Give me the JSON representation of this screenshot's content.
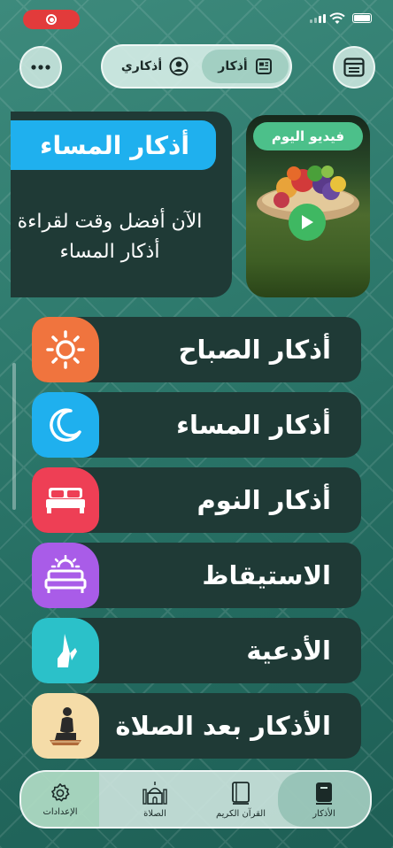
{
  "status_bar": {
    "recording": true
  },
  "header": {
    "segments": [
      {
        "label": "أذكار",
        "active": true,
        "icon": "news-icon"
      },
      {
        "label": "أذكاري",
        "active": false,
        "icon": "user-icon"
      }
    ],
    "left_button_icon": "more-icon",
    "right_button_icon": "list-icon"
  },
  "featured": {
    "title": "أذكار المساء",
    "line1": "الآن أفضل وقت لقراءة",
    "line2": "أذكار المساء",
    "video_title": "فيديو اليوم"
  },
  "items": [
    {
      "label": "أذكار الصباح",
      "color": "#f0743e",
      "icon": "sun-icon"
    },
    {
      "label": "أذكار المساء",
      "color": "#1fb0ee",
      "icon": "moon-icon"
    },
    {
      "label": "أذكار النوم",
      "color": "#ee3f55",
      "icon": "bed-icon"
    },
    {
      "label": "الاستيقاظ",
      "color": "#a95ce8",
      "icon": "wake-bed-icon"
    },
    {
      "label": "الأدعية",
      "color": "#2bc1c9",
      "icon": "prayer-hands-icon"
    },
    {
      "label": "الأذكار بعد الصلاة",
      "color": "#f5dca8",
      "icon": "praying-person-icon"
    }
  ],
  "tabs": [
    {
      "label": "الأذكار",
      "icon": "tasbih-book-icon",
      "active": true
    },
    {
      "label": "القرآن الكريم",
      "icon": "quran-icon",
      "active": false
    },
    {
      "label": "الصلاة",
      "icon": "mosque-icon",
      "active": false
    },
    {
      "label": "الإعدادات",
      "icon": "gear-icon",
      "active": false
    }
  ]
}
